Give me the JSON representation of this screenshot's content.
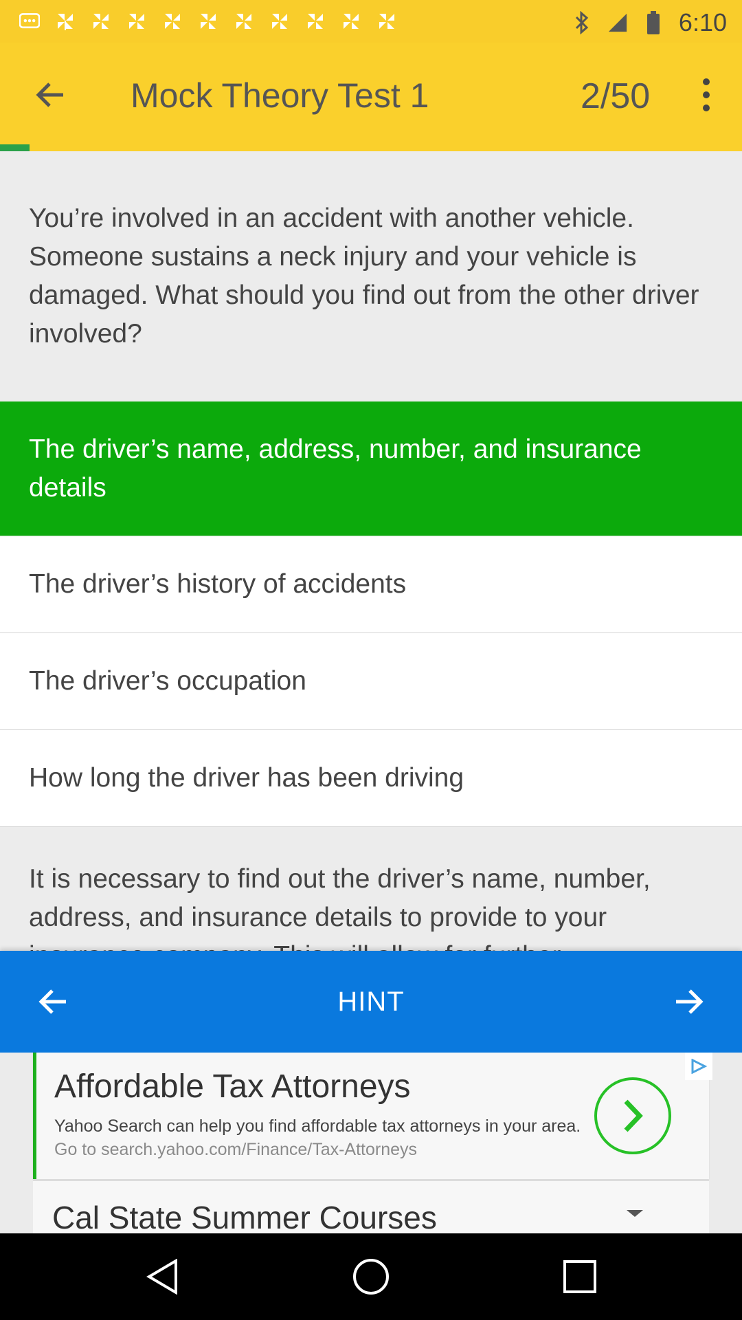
{
  "status_bar": {
    "time": "6:10",
    "left_icons": [
      "message-icon",
      "pinwheel-icon",
      "pinwheel-icon",
      "pinwheel-icon",
      "pinwheel-icon",
      "pinwheel-icon",
      "pinwheel-icon",
      "pinwheel-icon",
      "pinwheel-icon",
      "pinwheel-icon",
      "pinwheel-icon",
      "pinwheel-icon"
    ],
    "right_icons": [
      "bluetooth-icon",
      "signal-icon",
      "battery-icon"
    ]
  },
  "app_bar": {
    "title": "Mock Theory Test 1",
    "counter": "2/50",
    "progress_fraction": 0.04
  },
  "question": {
    "text": "You’re involved in an accident with another vehicle. Someone sustains a neck injury and your vehicle is damaged. What should you find out from the other driver involved?"
  },
  "answers": [
    {
      "text": "The driver’s name, address, number, and insurance details",
      "state": "correct"
    },
    {
      "text": "The driver’s history of accidents",
      "state": "default"
    },
    {
      "text": "The driver’s occupation",
      "state": "default"
    },
    {
      "text": "How long the driver has been driving",
      "state": "default"
    }
  ],
  "explanation": {
    "text": "It is necessary to find out the driver’s name, number, address, and insurance details to provide to your insurance company. This will allow for further"
  },
  "hint_bar": {
    "label": "HINT"
  },
  "ad": {
    "title": "Affordable Tax Attorneys",
    "description": "Yahoo Search can help you find affordable tax attorneys in your area.",
    "url": "Go to search.yahoo.com/Finance/Tax-Attorneys",
    "second_title": "Cal State Summer Courses"
  },
  "colors": {
    "app_bar": "#fad02c",
    "correct_answer": "#0caa0c",
    "hint_bar": "#0a79de",
    "progress": "#2aa14a"
  }
}
